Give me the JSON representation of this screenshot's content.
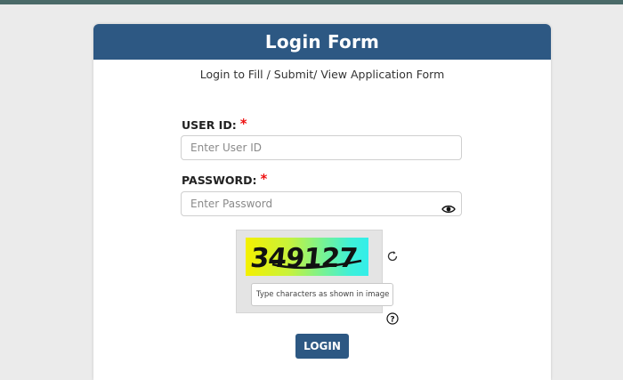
{
  "header": {
    "title": "Login Form"
  },
  "subtitle": "Login to Fill / Submit/ View Application Form",
  "user_id": {
    "label": "USER ID:",
    "required_mark": "*",
    "placeholder": "Enter User ID",
    "value": ""
  },
  "password": {
    "label": "PASSWORD:",
    "required_mark": "*",
    "placeholder": "Enter Password",
    "value": ""
  },
  "captcha": {
    "code": "349127",
    "input_placeholder": "Type characters as shown in image",
    "input_value": ""
  },
  "login_button": {
    "label": "LOGIN"
  },
  "icons": {
    "toggle_password": "eye-icon",
    "refresh_captcha": "refresh-icon",
    "help": "help-icon"
  },
  "colors": {
    "header": "#2d5883",
    "button": "#2d5883",
    "required": "#e11111",
    "page_bg": "#ebebeb"
  }
}
